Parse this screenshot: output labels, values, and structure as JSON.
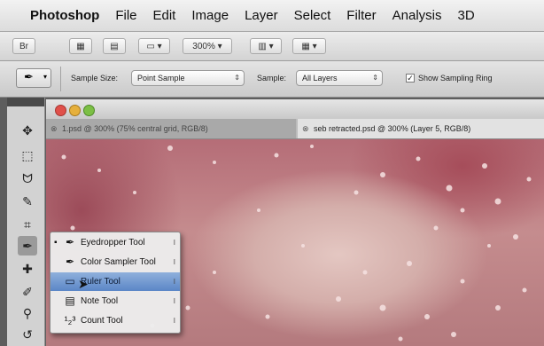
{
  "menubar": {
    "app_name": "Photoshop",
    "items": [
      "File",
      "Edit",
      "Image",
      "Layer",
      "Select",
      "Filter",
      "Analysis",
      "3D"
    ]
  },
  "appbar": {
    "zoom": "300%"
  },
  "options": {
    "sample_size_label": "Sample Size:",
    "sample_size_value": "Point Sample",
    "sample_label": "Sample:",
    "sample_value": "All Layers",
    "show_ring_label": "Show Sampling Ring",
    "show_ring_checked": true
  },
  "document": {
    "tabs": [
      {
        "label": "1.psd @ 300% (75% central grid, RGB/8)",
        "active": false
      },
      {
        "label": "seb retracted.psd @ 300% (Layer 5, RGB/8)",
        "active": true
      }
    ]
  },
  "flyout": {
    "items": [
      {
        "label": "Eyedropper Tool",
        "icon": "eyedropper-icon",
        "current": true
      },
      {
        "label": "Color Sampler Tool",
        "icon": "color-sampler-icon",
        "current": false
      },
      {
        "label": "Ruler Tool",
        "icon": "ruler-icon",
        "current": false,
        "highlighted": true
      },
      {
        "label": "Note Tool",
        "icon": "note-icon",
        "current": false
      },
      {
        "label": "Count Tool",
        "icon": "count-icon",
        "current": false
      }
    ]
  },
  "colors": {
    "canvas_pink": "#c58c8e",
    "highlight_blue": "#5b86c7"
  }
}
